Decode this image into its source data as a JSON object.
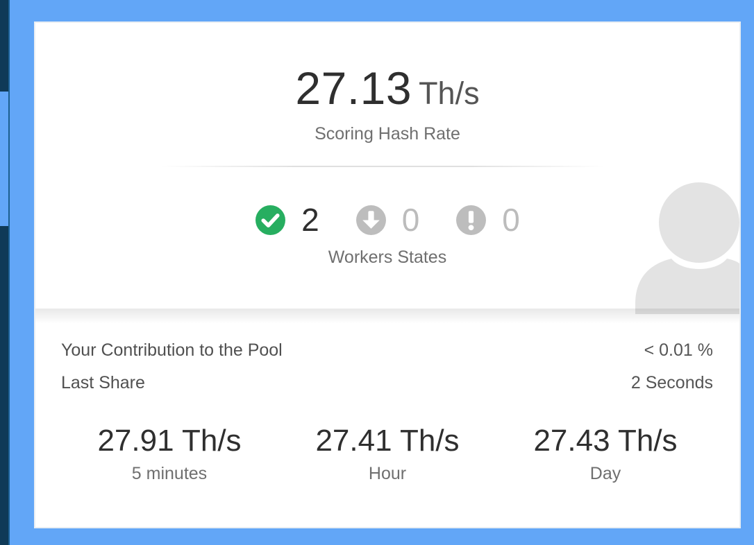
{
  "hash_rate": {
    "value": "27.13",
    "unit": "Th/s",
    "label": "Scoring Hash Rate"
  },
  "workers": {
    "label": "Workers States",
    "states": [
      {
        "icon": "check-circle-icon",
        "count": "2",
        "color": "#27ae60"
      },
      {
        "icon": "arrow-down-circle-icon",
        "count": "0",
        "color": "#bdbdbd"
      },
      {
        "icon": "exclamation-circle-icon",
        "count": "0",
        "color": "#bdbdbd"
      }
    ]
  },
  "details": {
    "contribution": {
      "label": "Your Contribution to the Pool",
      "value": "< 0.01 %"
    },
    "last_share": {
      "label": "Last Share",
      "value": "2 Seconds"
    }
  },
  "averages": [
    {
      "value": "27.91 Th/s",
      "label": "5 minutes"
    },
    {
      "value": "27.41 Th/s",
      "label": "Hour"
    },
    {
      "value": "27.43 Th/s",
      "label": "Day"
    }
  ],
  "colors": {
    "background": "#62a6f7",
    "sidebar": "#0f3a57",
    "card": "#ffffff",
    "ok": "#27ae60",
    "muted_icon": "#bdbdbd",
    "avatar": "#e3e3e3"
  },
  "avatar_icon": "user-silhouette-icon"
}
